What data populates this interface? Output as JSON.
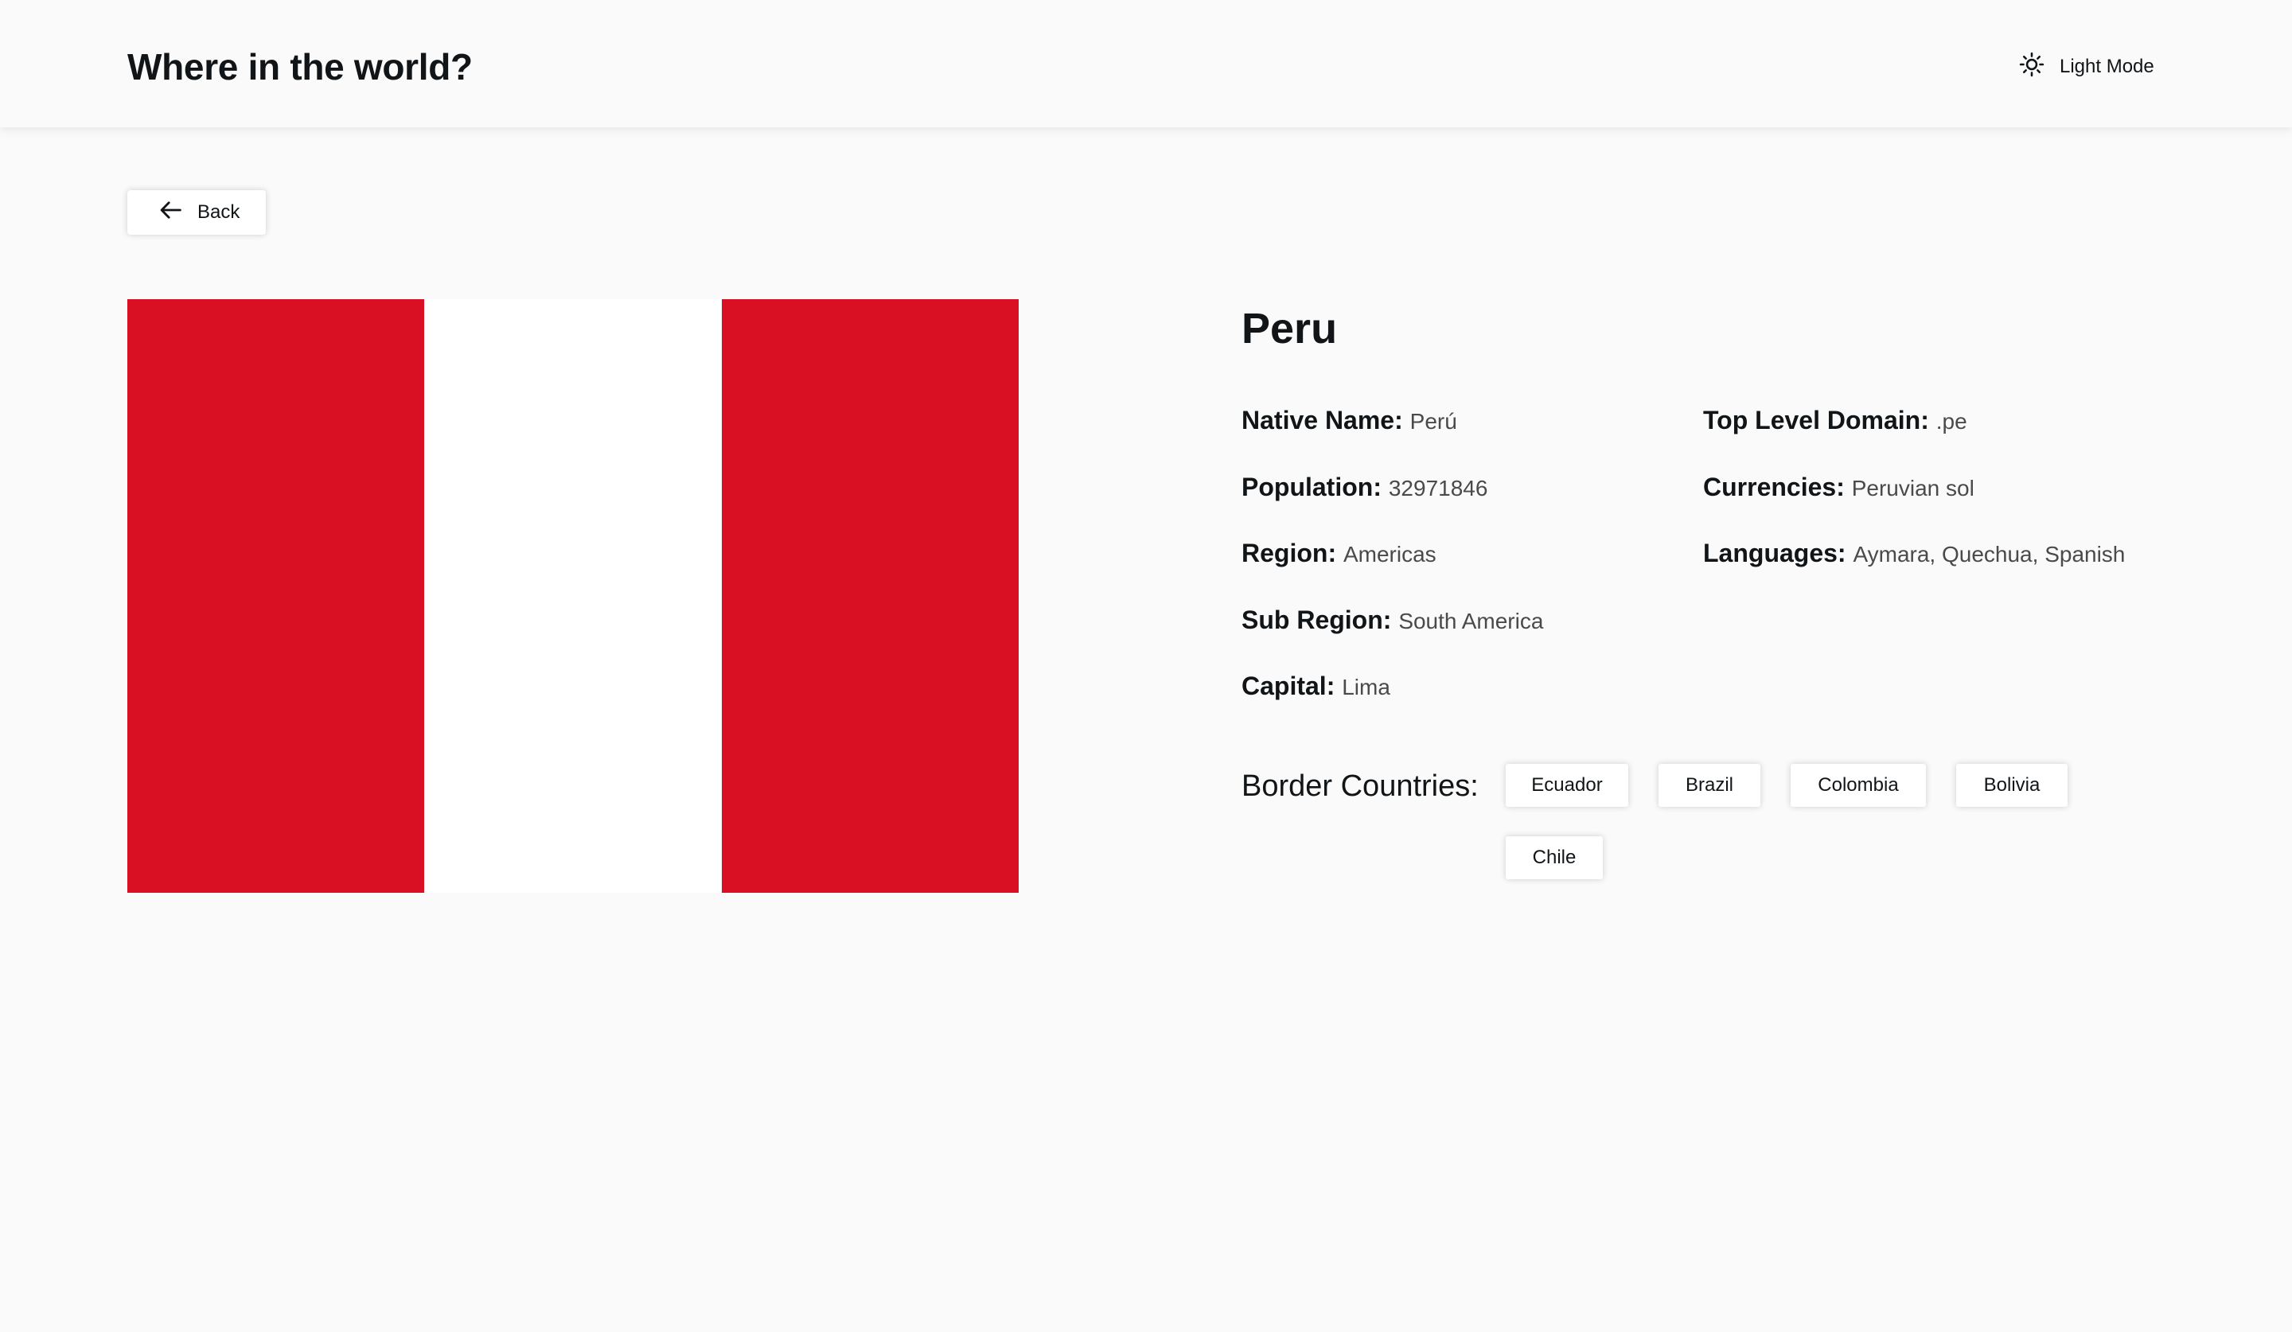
{
  "header": {
    "title": "Where in the world?",
    "theme_toggle_label": "Light Mode",
    "theme_icon": "sun-icon"
  },
  "navigation": {
    "back_label": "Back",
    "back_icon": "arrow-left-icon"
  },
  "country": {
    "name": "Peru",
    "flag_colors": [
      "#d91023",
      "#ffffff",
      "#d91023"
    ],
    "details_left": [
      {
        "label": "Native Name:",
        "value": "Perú"
      },
      {
        "label": "Population:",
        "value": "32971846"
      },
      {
        "label": "Region:",
        "value": "Americas"
      },
      {
        "label": "Sub Region:",
        "value": "South America"
      },
      {
        "label": "Capital:",
        "value": "Lima"
      }
    ],
    "details_right": [
      {
        "label": "Top Level Domain:",
        "value": ".pe"
      },
      {
        "label": "Currencies:",
        "value": "Peruvian sol"
      },
      {
        "label": "Languages:",
        "value": "Aymara, Quechua, Spanish"
      }
    ],
    "border_label": "Border Countries:",
    "border_countries": [
      "Ecuador",
      "Brazil",
      "Colombia",
      "Bolivia",
      "Chile"
    ]
  }
}
